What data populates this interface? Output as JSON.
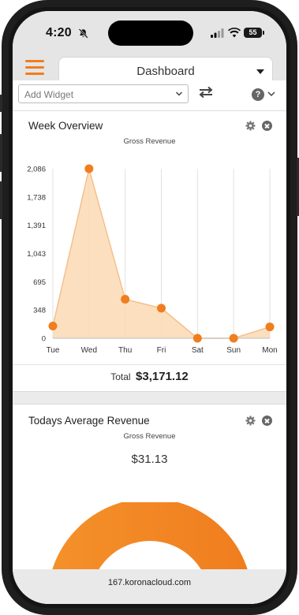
{
  "status_bar": {
    "time": "4:20",
    "battery": "55"
  },
  "header": {
    "dashboard_title": "Dashboard"
  },
  "widget_bar": {
    "add_widget_placeholder": "Add Widget",
    "help_glyph": "?"
  },
  "week_overview": {
    "title": "Week Overview",
    "subtitle": "Gross Revenue",
    "total_label": "Total",
    "total_value": "$3,171.12"
  },
  "todays_average": {
    "title": "Todays Average Revenue",
    "subtitle": "Gross Revenue",
    "value": "$31.13"
  },
  "browser": {
    "url": "167.koronacloud.com"
  },
  "colors": {
    "accent": "#f07d1e",
    "area_fill": "#fbd9b3",
    "area_line": "#f4c08d",
    "point": "#f07d1e"
  },
  "icons": [
    "bell-slash-icon",
    "signal-icon",
    "wifi-icon",
    "battery-icon",
    "hamburger-menu-icon",
    "caret-down-icon",
    "swap-icon",
    "help-icon",
    "gear-icon",
    "close-icon"
  ],
  "chart_data": [
    {
      "type": "area",
      "title": "Week Overview",
      "subtitle": "Gross Revenue",
      "categories": [
        "Tue",
        "Wed",
        "Thu",
        "Fri",
        "Sat",
        "Sun",
        "Mon"
      ],
      "series": [
        {
          "values": [
            150,
            2086,
            480,
            370,
            0,
            0,
            140
          ]
        }
      ],
      "yticks": [
        "0",
        "348",
        "695",
        "1,043",
        "1,391",
        "1,738",
        "2,086"
      ],
      "ylim": [
        0,
        2086
      ],
      "grid": "vertical"
    },
    {
      "type": "pie",
      "title": "Todays Average Revenue",
      "subtitle": "Gross Revenue",
      "value": "$31.13",
      "partially_visible": true
    }
  ]
}
